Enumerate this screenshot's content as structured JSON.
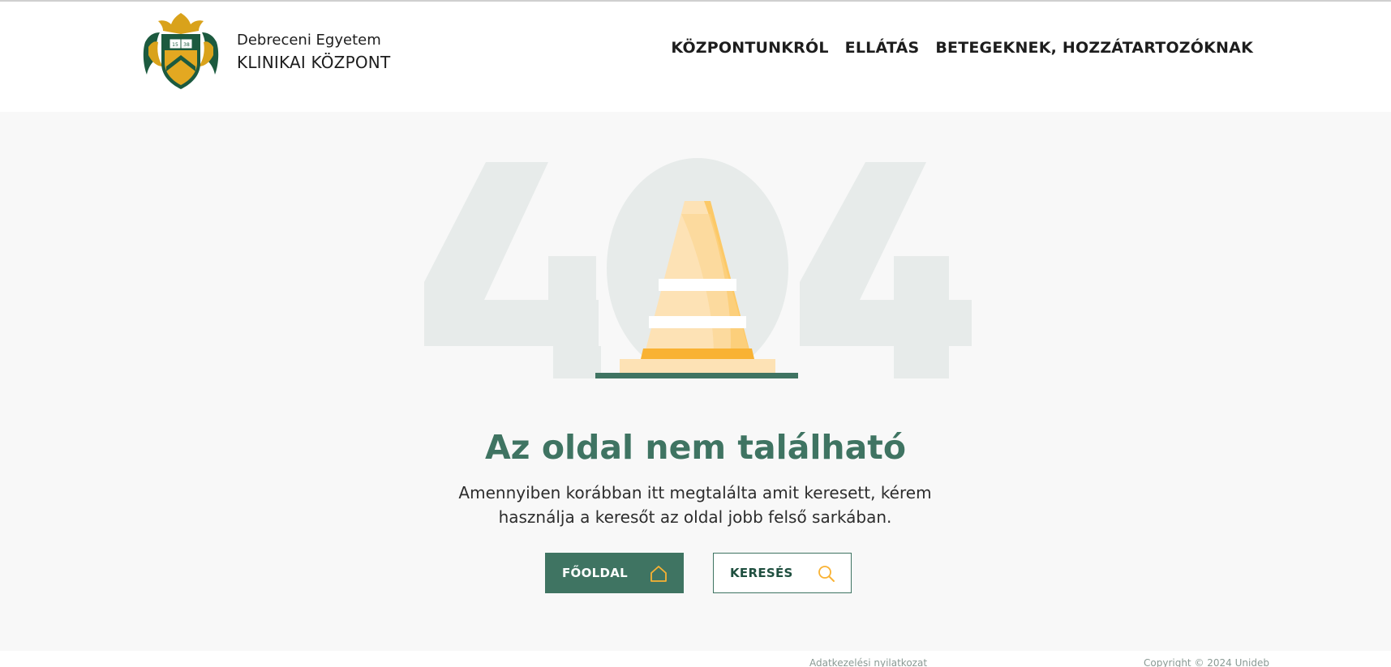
{
  "header": {
    "brand_top": "Debreceni Egyetem",
    "brand_bottom": "KLINIKAI KÖZPONT",
    "logo_year": "1538",
    "nav": [
      {
        "label": "KÖZPONTUNKRÓL"
      },
      {
        "label": "ELLÁTÁS"
      },
      {
        "label": "BETEGEKNEK, HOZZÁTARTOZÓKNAK"
      }
    ]
  },
  "error": {
    "code": "404",
    "title": "Az oldal nem található",
    "description": "Amennyiben korábban itt megtalálta amit keresett, kérem használja a keresőt az oldal jobb felső sarkában."
  },
  "buttons": {
    "home_label": "FŐOLDAL",
    "home_icon": "home-icon",
    "search_label": "KERESÉS",
    "search_icon": "search-icon"
  },
  "footer": {
    "privacy_link": "Adatkezelési nyilatkozat",
    "copyright": "Copyright © 2024 Unideb"
  },
  "colors": {
    "accent_green": "#3f7462",
    "cone_orange": "#f9b233",
    "digit_gray": "#e7ebea",
    "background": "#f8f8f8"
  }
}
